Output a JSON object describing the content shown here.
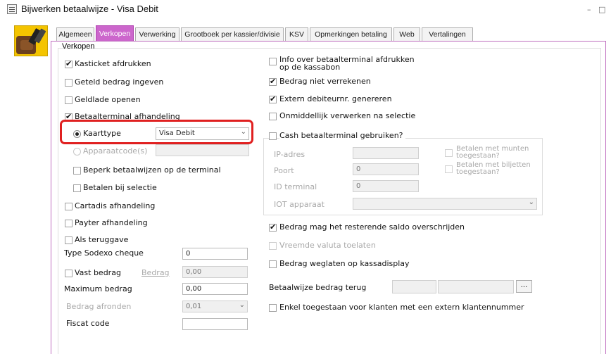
{
  "window": {
    "title": "Bijwerken betaalwijze - Visa Debit",
    "minimize": "–",
    "maximize": "□"
  },
  "tabs": [
    {
      "label": "Algemeen"
    },
    {
      "label": "Verkopen"
    },
    {
      "label": "Verwerking"
    },
    {
      "label": "Grootboek per kassier/divisie"
    },
    {
      "label": "KSV"
    },
    {
      "label": "Opmerkingen betaling"
    },
    {
      "label": "Web"
    },
    {
      "label": "Vertalingen"
    }
  ],
  "active_tab": "Verkopen",
  "group_label": "Verkopen",
  "left": {
    "kasticket": {
      "label": "Kasticket afdrukken",
      "checked": true
    },
    "geteld": {
      "label": "Geteld bedrag ingeven",
      "checked": false
    },
    "geldlade": {
      "label": "Geldlade openen",
      "checked": false
    },
    "betaalterminal": {
      "label": "Betaalterminal afhandeling",
      "checked": true
    },
    "kaarttype": {
      "label": "Kaarttype",
      "value": "Visa Debit"
    },
    "apparaatcode": {
      "label": "Apparaatcode(s)",
      "value": ""
    },
    "beperk": {
      "label": "Beperk betaalwijzen op de terminal",
      "checked": false
    },
    "betalen_selectie": {
      "label": "Betalen bij selectie",
      "checked": false
    },
    "cartadis": {
      "label": "Cartadis afhandeling",
      "checked": false
    },
    "payter": {
      "label": "Payter afhandeling",
      "checked": false
    },
    "teruggave": {
      "label": "Als teruggave",
      "checked": false
    },
    "sodexo": {
      "label": "Type Sodexo cheque",
      "value": "0"
    },
    "vast_bedrag": {
      "label": "Vast bedrag",
      "sub_label": "Bedrag",
      "value": "0,00"
    },
    "maximum": {
      "label": "Maximum bedrag",
      "value": "0,00"
    },
    "afronden": {
      "label": "Bedrag afronden",
      "value": "0,01"
    },
    "fiscat": {
      "label": "Fiscat code",
      "value": ""
    }
  },
  "right": {
    "info_terminal": {
      "label_line1": "Info over betaalterminal afdrukken",
      "label_line2": "op de kassabon",
      "checked": false
    },
    "niet_verrekenen": {
      "label": "Bedrag niet verrekenen",
      "checked": true
    },
    "extern_debiteur": {
      "label": "Extern debiteurnr. genereren",
      "checked": true
    },
    "onmiddellijk": {
      "label": "Onmiddellijk verwerken na selectie",
      "checked": false
    },
    "cash_terminal": {
      "label": "Cash betaalterminal gebruiken?",
      "checked": false
    },
    "ip_adres": {
      "label": "IP-adres",
      "value": ""
    },
    "poort": {
      "label": "Poort",
      "value": "0"
    },
    "id_terminal": {
      "label": "ID terminal",
      "value": "0"
    },
    "iot": {
      "label": "IOT apparaat",
      "value": ""
    },
    "munten": {
      "label_line1": "Betalen met munten",
      "label_line2": "toegestaan?",
      "checked": false
    },
    "biljetten": {
      "label_line1": "Betalen met biljetten",
      "label_line2": "toegestaan?",
      "checked": false
    },
    "saldo": {
      "label": "Bedrag mag het resterende saldo overschrijden",
      "checked": true
    },
    "vreemde_valuta": {
      "label": "Vreemde valuta toelaten",
      "checked": false
    },
    "weglaten": {
      "label": "Bedrag weglaten op kassadisplay",
      "checked": false
    },
    "terug": {
      "label": "Betaalwijze bedrag terug",
      "code": "",
      "name": "",
      "button": "..."
    },
    "enkel": {
      "label": "Enkel toegestaan voor klanten met een extern klantennummer",
      "checked": false
    }
  },
  "colors": {
    "accent": "#cc66cc",
    "highlight": "#e02020"
  }
}
